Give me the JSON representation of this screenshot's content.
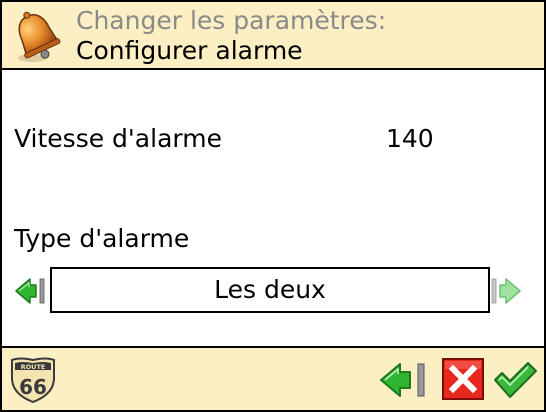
{
  "header": {
    "subtitle": "Changer les paramètres:",
    "title": "Configurer alarme",
    "icon": "bell-icon"
  },
  "settings": {
    "speed": {
      "label": "Vitesse d'alarme",
      "value": "140"
    },
    "alarm_type": {
      "label": "Type d'alarme",
      "selected": "Les deux"
    }
  },
  "footer": {
    "logo_text_top": "ROUTE",
    "logo_text_number": "66",
    "buttons": [
      "back-icon",
      "cancel-icon",
      "ok-icon"
    ]
  },
  "colors": {
    "header_bg": "#fbefc3",
    "arrow_green": "#2fb52f",
    "arrow_disabled": "#9ee29e",
    "cancel_red": "#e8281e",
    "check_green": "#3bb83b"
  }
}
